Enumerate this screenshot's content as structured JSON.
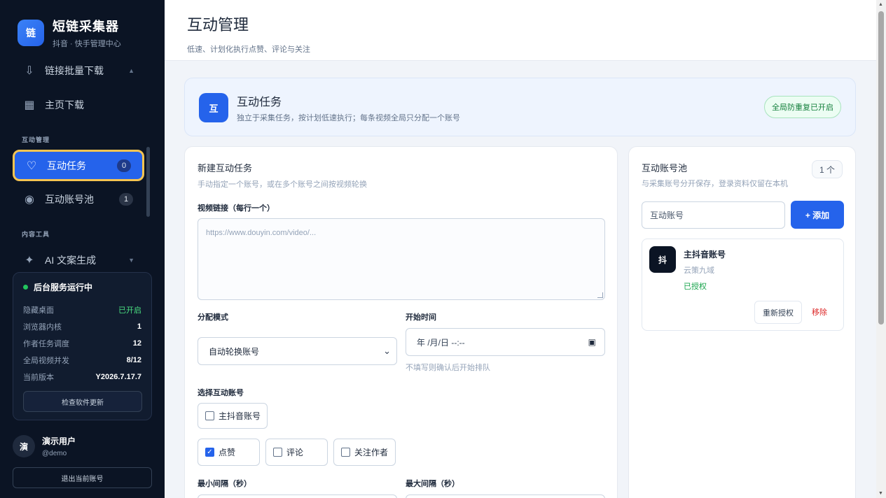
{
  "sidebar": {
    "brand": {
      "logo": "链",
      "title": "短链采集器",
      "subtitle": "抖音 · 快手管理中心"
    },
    "items": [
      {
        "label": "链接批量下载",
        "icon": "download-icon"
      },
      {
        "label": "主页下载",
        "icon": "grid-icon"
      }
    ],
    "section_interaction": "互动管理",
    "interaction_items": [
      {
        "label": "互动任务",
        "count": "0",
        "icon": "heart-icon",
        "active": true
      },
      {
        "label": "互动账号池",
        "count": "1",
        "icon": "circle-icon"
      }
    ],
    "section_tools": "内容工具",
    "tool_items": [
      {
        "label": "AI 文案生成",
        "icon": "sparkle-icon"
      }
    ],
    "status": {
      "title": "后台服务运行中",
      "rows": [
        {
          "label": "隐藏桌面",
          "value": "已开启"
        },
        {
          "label": "浏览器内核",
          "value": "1"
        },
        {
          "label": "作者任务调度",
          "value": "12"
        },
        {
          "label": "全局视频并发",
          "value": "8/12"
        },
        {
          "label": "当前版本",
          "value": "Y2026.7.17.7"
        }
      ],
      "update_label": "检查软件更新"
    },
    "user": {
      "avatar": "演",
      "name": "演示用户",
      "handle": "@demo"
    },
    "logout_label": "退出当前账号"
  },
  "header": {
    "title": "互动管理",
    "subtitle": "低速、计划化执行点赞、评论与关注"
  },
  "banner": {
    "logo": "互",
    "title": "互动任务",
    "subtitle": "独立于采集任务，按计划低速执行；每条视频全局只分配一个账号",
    "badge": "全局防重复已开启"
  },
  "form": {
    "title": "新建互动任务",
    "subtitle": "手动指定一个账号，或在多个账号之间按视频轮换",
    "links_label": "视频链接（每行一个）",
    "links_placeholder": "https://www.douyin.com/video/...",
    "mode_label": "分配模式",
    "mode_value": "自动轮换账号",
    "start_label": "开始时间",
    "start_placeholder": "年 /月/日  --:--",
    "start_hint": "不填写则确认后开始排队",
    "accounts_label": "选择互动账号",
    "account_option": "主抖音账号",
    "actions": [
      {
        "label": "点赞",
        "checked": true
      },
      {
        "label": "评论",
        "checked": false
      },
      {
        "label": "关注作者",
        "checked": false
      }
    ],
    "min_label": "最小间隔（秒）",
    "max_label": "最大间隔（秒）"
  },
  "pool": {
    "title": "互动账号池",
    "subtitle": "与采集账号分开保存，登录资料仅留在本机",
    "count": "1 个",
    "input_placeholder": "互动账号",
    "add_label": "+ 添加",
    "account": {
      "logo": "抖",
      "name": "主抖音账号",
      "org": "云策九域",
      "status": "已授权"
    },
    "reauth_label": "重新授权",
    "remove_label": "移除"
  }
}
